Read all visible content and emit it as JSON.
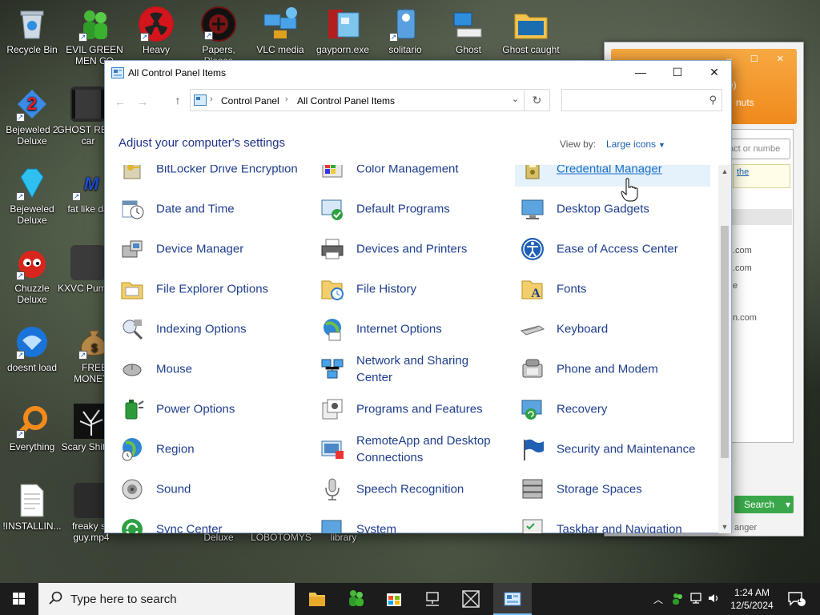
{
  "desktop": {
    "icons": [
      {
        "label": "Recycle Bin"
      },
      {
        "label": "EVIL GREEN MEN CO"
      },
      {
        "label": "Heavy"
      },
      {
        "label": "Papers, Please"
      },
      {
        "label": "VLC media"
      },
      {
        "label": "gayporn.exe"
      },
      {
        "label": "solitario"
      },
      {
        "label": "Ghost"
      },
      {
        "label": "Ghost caught"
      },
      {
        "label": "Bejeweled 2 Deluxe"
      },
      {
        "label": "GHOST REAL car"
      },
      {
        "label": "Bejeweled Deluxe"
      },
      {
        "label": "fat like da"
      },
      {
        "label": "Chuzzle Deluxe"
      },
      {
        "label": "KXVC Pumpki"
      },
      {
        "label": "doesnt load"
      },
      {
        "label": "FREE MONEY.c"
      },
      {
        "label": "Everything"
      },
      {
        "label": "Scary Shit.mp"
      },
      {
        "label": "!INSTALLIN..."
      },
      {
        "label": "freaky sc guy.mp4"
      },
      {
        "label": "Deluxe"
      },
      {
        "label": "LOBOTOMYS"
      },
      {
        "label": "library"
      }
    ]
  },
  "background_window": {
    "text_1": "e)",
    "text_2": "nuts",
    "field_placeholder": "act or numbe",
    "link": "the",
    "mails": [
      ".com",
      ".com",
      "e",
      "n.com"
    ],
    "search_label": "Search",
    "footer_text": "anger"
  },
  "control_panel": {
    "title": "All Control Panel Items",
    "address": {
      "crumb_1": "Control Panel",
      "crumb_2": "All Control Panel Items"
    },
    "search_placeholder": "",
    "heading": "Adjust your computer's settings",
    "view_by_label": "View by:",
    "view_by_value": "Large icons",
    "items": [
      {
        "label": "BitLocker Drive Encryption",
        "icon": "bitlocker-icon"
      },
      {
        "label": "Color Management",
        "icon": "color-management-icon"
      },
      {
        "label": "Credential Manager",
        "icon": "credential-manager-icon"
      },
      {
        "label": "Date and Time",
        "icon": "date-time-icon"
      },
      {
        "label": "Default Programs",
        "icon": "default-programs-icon"
      },
      {
        "label": "Desktop Gadgets",
        "icon": "desktop-gadgets-icon"
      },
      {
        "label": "Device Manager",
        "icon": "device-manager-icon"
      },
      {
        "label": "Devices and Printers",
        "icon": "printer-icon"
      },
      {
        "label": "Ease of Access Center",
        "icon": "ease-of-access-icon"
      },
      {
        "label": "File Explorer Options",
        "icon": "folder-options-icon"
      },
      {
        "label": "File History",
        "icon": "file-history-icon"
      },
      {
        "label": "Fonts",
        "icon": "fonts-icon"
      },
      {
        "label": "Indexing Options",
        "icon": "indexing-icon"
      },
      {
        "label": "Internet Options",
        "icon": "internet-options-icon"
      },
      {
        "label": "Keyboard",
        "icon": "keyboard-icon"
      },
      {
        "label": "Mouse",
        "icon": "mouse-icon"
      },
      {
        "label": "Network and Sharing Center",
        "icon": "network-icon"
      },
      {
        "label": "Phone and Modem",
        "icon": "phone-icon"
      },
      {
        "label": "Power Options",
        "icon": "power-icon"
      },
      {
        "label": "Programs and Features",
        "icon": "programs-icon"
      },
      {
        "label": "Recovery",
        "icon": "recovery-icon"
      },
      {
        "label": "Region",
        "icon": "region-icon"
      },
      {
        "label": "RemoteApp and Desktop Connections",
        "icon": "remoteapp-icon"
      },
      {
        "label": "Security and Maintenance",
        "icon": "flag-icon"
      },
      {
        "label": "Sound",
        "icon": "sound-icon"
      },
      {
        "label": "Speech Recognition",
        "icon": "microphone-icon"
      },
      {
        "label": "Storage Spaces",
        "icon": "storage-icon"
      },
      {
        "label": "Sync Center",
        "icon": "sync-icon"
      },
      {
        "label": "System",
        "icon": "system-icon"
      },
      {
        "label": "Taskbar and Navigation",
        "icon": "taskbar-icon"
      }
    ],
    "hovered_item": "Credential Manager"
  },
  "taskbar": {
    "search_placeholder": "Type here to search",
    "time": "1:24 AM",
    "date": "12/5/2024",
    "notification_count": "1",
    "accent": "#76b9ed"
  }
}
